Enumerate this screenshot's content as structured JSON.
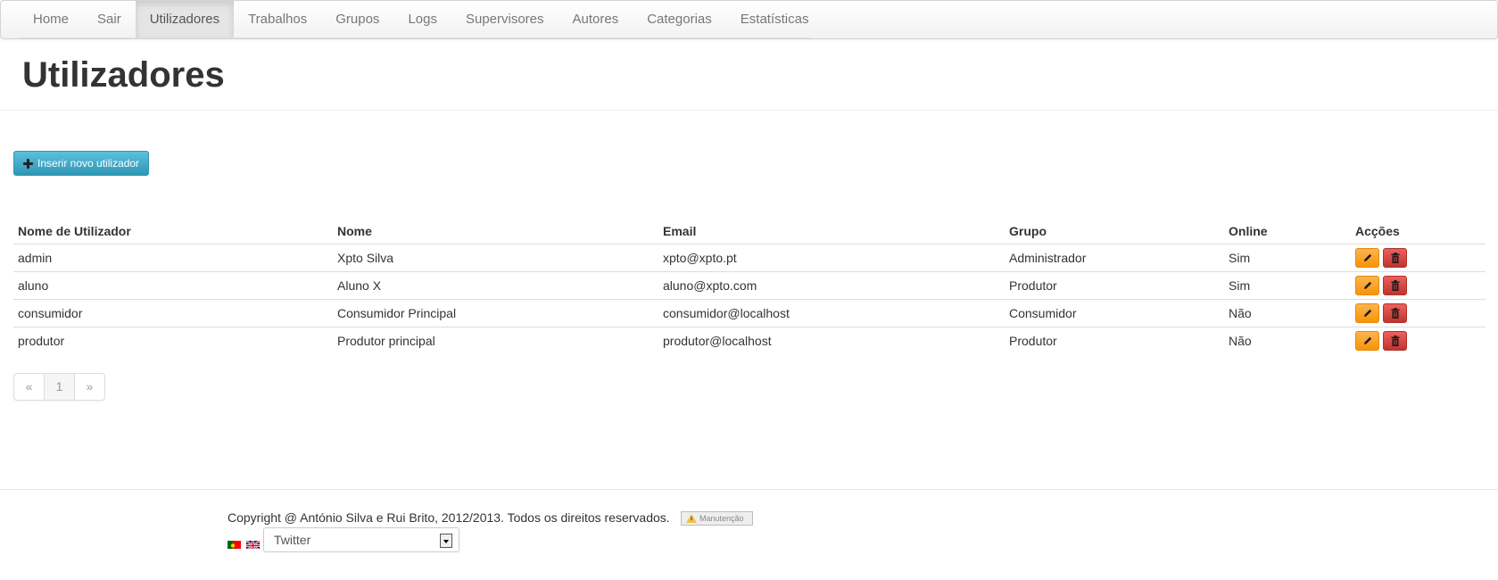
{
  "nav": {
    "items": [
      {
        "label": "Home"
      },
      {
        "label": "Sair"
      },
      {
        "label": "Utilizadores",
        "active": true
      },
      {
        "label": "Trabalhos"
      },
      {
        "label": "Grupos"
      },
      {
        "label": "Logs"
      },
      {
        "label": "Supervisores"
      },
      {
        "label": "Autores"
      },
      {
        "label": "Categorias"
      },
      {
        "label": "Estatísticas"
      }
    ]
  },
  "page": {
    "title": "Utilizadores"
  },
  "insert_button": {
    "label": "Inserir novo utilizador",
    "icon": "plus-icon"
  },
  "table": {
    "headers": [
      "Nome de Utilizador",
      "Nome",
      "Email",
      "Grupo",
      "Online",
      "Acções"
    ],
    "rows": [
      {
        "username": "admin",
        "name": "Xpto Silva",
        "email": "xpto@xpto.pt",
        "group": "Administrador",
        "online": "Sim"
      },
      {
        "username": "aluno",
        "name": "Aluno X",
        "email": "aluno@xpto.com",
        "group": "Produtor",
        "online": "Sim"
      },
      {
        "username": "consumidor",
        "name": "Consumidor Principal",
        "email": "consumidor@localhost",
        "group": "Consumidor",
        "online": "Não"
      },
      {
        "username": "produtor",
        "name": "Produtor principal",
        "email": "produtor@localhost",
        "group": "Produtor",
        "online": "Não"
      }
    ],
    "actions": [
      {
        "name": "edit",
        "icon": "pencil-icon",
        "color": "#f89406"
      },
      {
        "name": "delete",
        "icon": "trash-icon",
        "color": "#bd362f"
      }
    ]
  },
  "pagination": {
    "prev": "«",
    "current": "1",
    "next": "»"
  },
  "footer": {
    "copyright": "Copyright @ António Silva e Rui Brito, 2012/2013. Todos os direitos reservados.",
    "maintenance_badge": "Manutenção",
    "flags": [
      "pt-flag-icon",
      "uk-flag-icon"
    ],
    "social_select": {
      "value": "Twitter"
    }
  },
  "colors": {
    "info_button": "#2f96b4",
    "warning_button": "#f89406",
    "danger_button": "#bd362f"
  }
}
